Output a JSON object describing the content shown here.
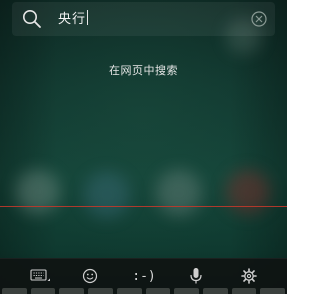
{
  "search": {
    "query": "央行",
    "icon": "search-icon",
    "clear_icon": "clear-icon"
  },
  "suggestion": {
    "web_search_label": "在网页中搜索"
  },
  "toolbar": {
    "items": [
      {
        "name": "keyboard-icon"
      },
      {
        "name": "emoji-icon"
      },
      {
        "name": "emoticon-icon",
        "label": ":-)"
      },
      {
        "name": "mic-icon"
      },
      {
        "name": "settings-icon"
      }
    ]
  },
  "colors": {
    "background": "#123a31",
    "divider_line": "#c0392b",
    "text": "#f2f2f2",
    "toolbar_bg": "#0f1412"
  }
}
